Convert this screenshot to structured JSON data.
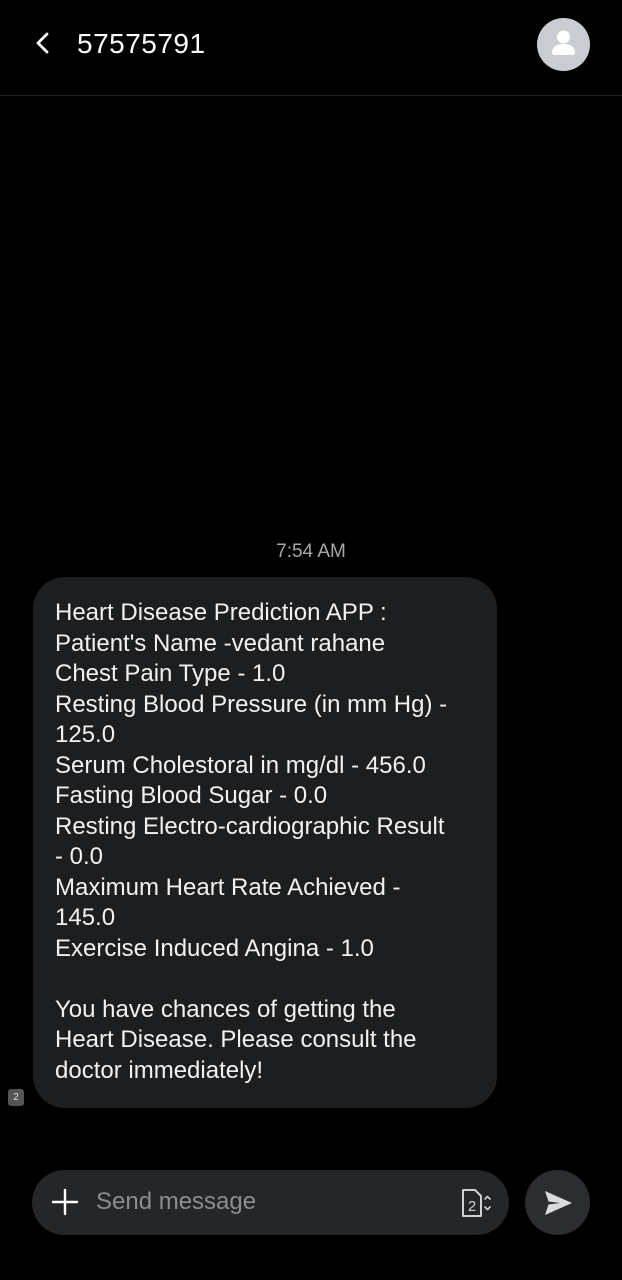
{
  "header": {
    "title": "57575791",
    "back_icon": "chevron-left-icon",
    "avatar_icon": "person-icon"
  },
  "conversation": {
    "timestamp": "7:54 AM",
    "messages": [
      {
        "text": "Heart Disease Prediction APP :\nPatient's Name -vedant rahane\nChest Pain Type - 1.0\nResting Blood Pressure (in mm Hg) -\n125.0\nSerum Cholestoral in mg/dl - 456.0\nFasting Blood Sugar - 0.0\nResting Electro-cardiographic Result\n- 0.0\nMaximum Heart Rate Achieved -\n145.0\nExercise Induced Angina - 1.0\n\nYou have chances of getting the\nHeart Disease. Please consult the\ndoctor immediately!",
        "sim_label": "2"
      }
    ]
  },
  "composer": {
    "placeholder": "Send message",
    "value": "",
    "sim_label": "2"
  },
  "colors": {
    "background": "#000000",
    "bubble": "#1c1e1f",
    "composer": "#242628",
    "avatar": "#c9cdd2"
  }
}
